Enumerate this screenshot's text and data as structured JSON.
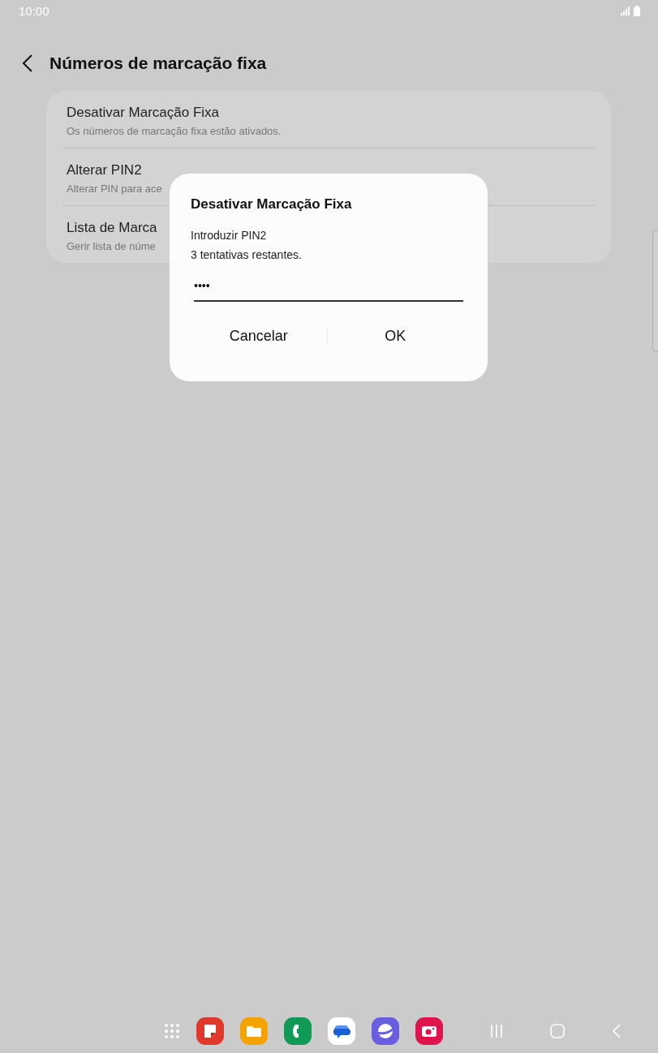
{
  "status_bar": {
    "time": "10:00"
  },
  "header": {
    "title": "Números de marcação fixa"
  },
  "settings": [
    {
      "title": "Desativar Marcação Fixa",
      "subtitle": "Os números de marcação fixa estão ativados."
    },
    {
      "title": "Alterar PIN2",
      "subtitle": "Alterar PIN para ace"
    },
    {
      "title": "Lista de Marca",
      "subtitle": "Gerir lista de núme"
    }
  ],
  "dialog": {
    "title": "Desativar Marcação Fixa",
    "lines": [
      "Introduzir PIN2",
      "3 tentativas restantes."
    ],
    "pin": {
      "value": "••••"
    },
    "buttons": [
      "Cancelar",
      "OK"
    ]
  },
  "dock": {
    "apps": [
      {
        "kind": "notes"
      },
      {
        "kind": "files"
      },
      {
        "kind": "phone"
      },
      {
        "kind": "messages"
      },
      {
        "kind": "browser"
      },
      {
        "kind": "camera"
      }
    ]
  }
}
